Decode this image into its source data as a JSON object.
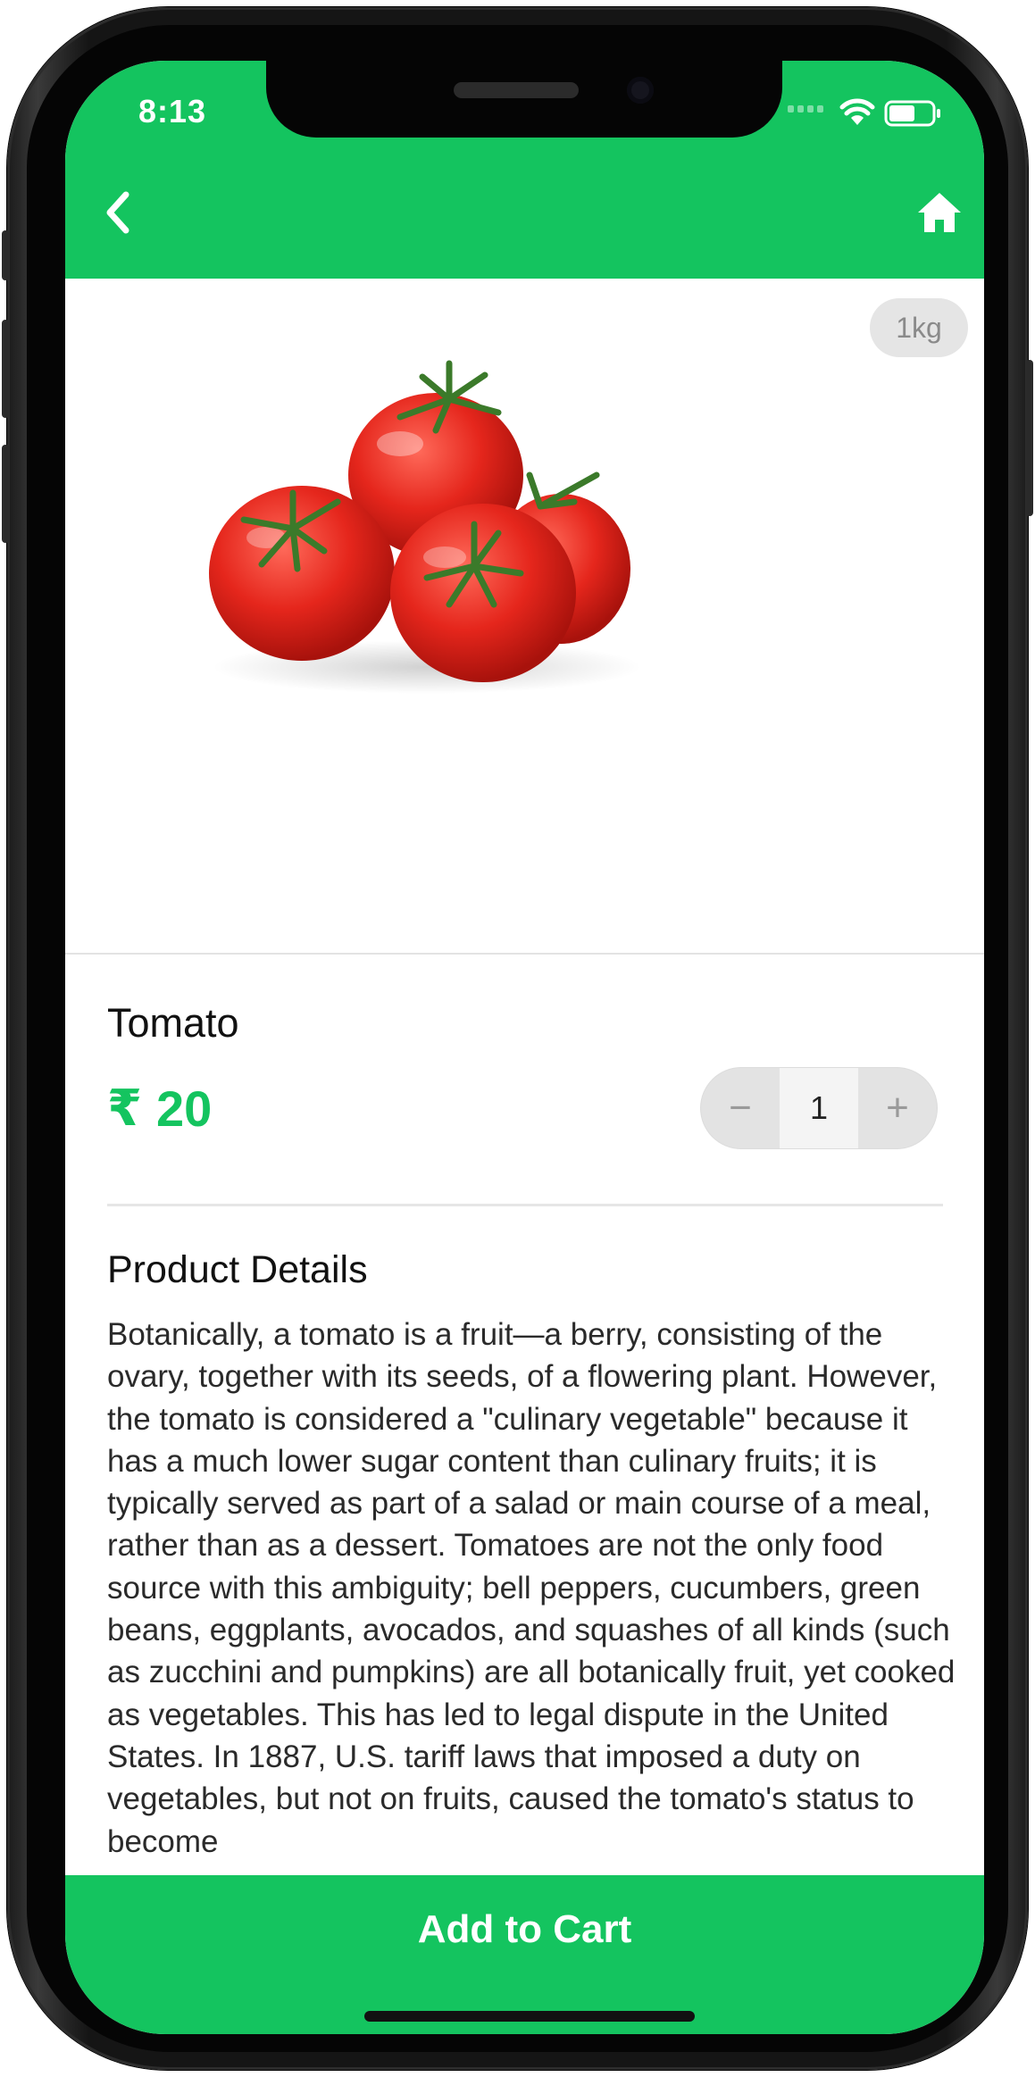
{
  "status_bar": {
    "time": "8:13"
  },
  "product": {
    "weight_badge": "1kg",
    "name": "Tomato",
    "currency_symbol": "₹",
    "price": "20",
    "quantity": "1",
    "minus_label": "−",
    "plus_label": "+"
  },
  "details": {
    "title": "Product Details",
    "body": "Botanically, a tomato is a fruit—a berry, consisting of the ovary, together with its seeds, of a flowering plant. However, the tomato is considered a \"culinary vegetable\" because it has a much lower sugar content than culinary fruits; it is typically served as part of a salad or main course of a meal, rather than as a dessert. Tomatoes are not the only food source with this ambiguity; bell peppers, cucumbers, green beans, eggplants, avocados, and squashes of all kinds (such as zucchini and pumpkins) are all botanically fruit, yet cooked as vegetables. This has led to legal dispute in the United States. In 1887, U.S. tariff laws that imposed a duty on vegetables, but not on fruits, caused the tomato's status to become"
  },
  "cart_button": {
    "label": "Add to Cart"
  },
  "colors": {
    "accent": "#14c45f",
    "badge_bg": "#e5e5e5",
    "text": "#111111"
  },
  "icons": {
    "back": "chevron-left-icon",
    "home": "home-icon",
    "signal": "signal-icon",
    "wifi": "wifi-icon",
    "battery": "battery-icon"
  }
}
